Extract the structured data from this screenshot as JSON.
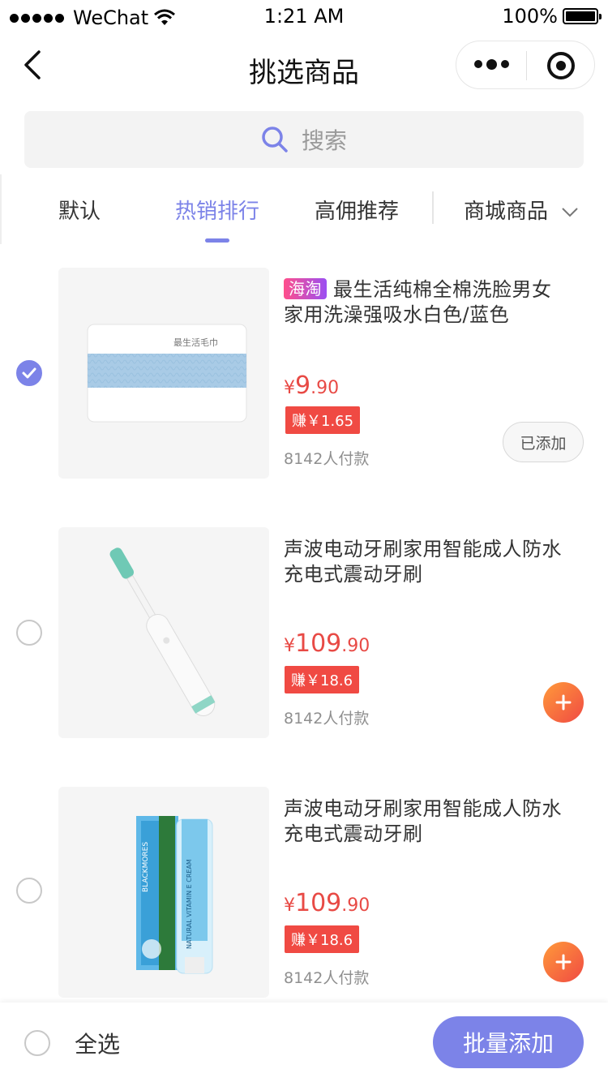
{
  "status_bar": {
    "carrier": "WeChat",
    "time": "1:21 AM",
    "battery": "100%",
    "battery_level": 1.0
  },
  "nav": {
    "title": "挑选商品"
  },
  "search": {
    "placeholder": "搜索"
  },
  "tabs": [
    {
      "label": "默认",
      "active": false
    },
    {
      "label": "热销排行",
      "active": true
    },
    {
      "label": "高佣推荐",
      "active": false
    },
    {
      "label": "商城商品",
      "active": false
    }
  ],
  "products": [
    {
      "tag": "海淘",
      "title": "最生活纯棉全棉洗脸男女家用洗澡强吸水白色/蓝色",
      "price_symbol": "¥",
      "price_int": "9",
      "price_dec": ".90",
      "earn": "赚￥1.65",
      "sold": "8142人付款",
      "checked": true,
      "action": "已添加",
      "image_text": "最生活毛巾"
    },
    {
      "title": "声波电动牙刷家用智能成人防水充电式震动牙刷",
      "price_symbol": "¥",
      "price_int": "109",
      "price_dec": ".90",
      "earn": "赚￥18.6",
      "sold": "8142人付款",
      "checked": false,
      "action": "add"
    },
    {
      "title": "声波电动牙刷家用智能成人防水充电式震动牙刷",
      "price_symbol": "¥",
      "price_int": "109",
      "price_dec": ".90",
      "earn": "赚￥18.6",
      "sold": "8142人付款",
      "checked": false,
      "action": "add",
      "image_text": "NATURAL VITAMIN E CREAM",
      "image_brand": "BLACKMORES"
    }
  ],
  "bottom": {
    "select_all": "全选",
    "batch_add": "批量添加"
  },
  "colors": {
    "accent": "#7c83e8",
    "price": "#e84a45",
    "earn_bg": "#f04a43"
  }
}
